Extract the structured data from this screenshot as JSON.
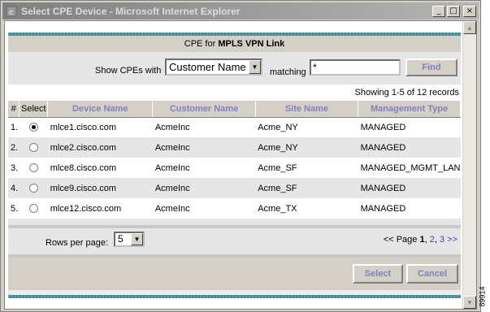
{
  "window": {
    "title": "Select CPE Device - Microsoft Internet Explorer",
    "minimize_glyph": "_",
    "maximize_glyph": "□",
    "close_glyph": "×"
  },
  "header": {
    "prefix": "CPE for ",
    "link_name": "MPLS VPN Link"
  },
  "filter": {
    "show_label": "Show CPEs with",
    "field_selected": "Customer Name",
    "matching_label": "matching",
    "search_value": "*",
    "find_label": "Find"
  },
  "records_text": "Showing 1-5 of 12 records",
  "table": {
    "columns": [
      "#",
      "Select",
      "Device Name",
      "Customer Name",
      "Site Name",
      "Management Type"
    ],
    "rows": [
      {
        "num": "1.",
        "selected": true,
        "device": "mlce1.cisco.com",
        "customer": "AcmeInc",
        "site": "Acme_NY",
        "mgmt": "MANAGED"
      },
      {
        "num": "2.",
        "selected": false,
        "device": "mlce2.cisco.com",
        "customer": "AcmeInc",
        "site": "Acme_NY",
        "mgmt": "MANAGED"
      },
      {
        "num": "3.",
        "selected": false,
        "device": "mlce8.cisco.com",
        "customer": "AcmeInc",
        "site": "Acme_SF",
        "mgmt": "MANAGED_MGMT_LAN"
      },
      {
        "num": "4.",
        "selected": false,
        "device": "mlce9.cisco.com",
        "customer": "AcmeInc",
        "site": "Acme_SF",
        "mgmt": "MANAGED"
      },
      {
        "num": "5.",
        "selected": false,
        "device": "mlce12.cisco.com",
        "customer": "AcmeInc",
        "site": "Acme_TX",
        "mgmt": "MANAGED"
      }
    ]
  },
  "pager": {
    "rows_label": "Rows per page:",
    "rows_value": "5",
    "prefix": "<< Page ",
    "current": "1",
    "sep1": ", ",
    "page2": "2",
    "sep2": ", ",
    "page3": "3",
    "next": " >>"
  },
  "actions": {
    "select_label": "Select",
    "cancel_label": "Cancel"
  },
  "figure_id": "89914",
  "colors": {
    "accent_text": "#8080c0",
    "teal_rule": "#3f8a90",
    "link": "#4040c0"
  },
  "icons": {
    "app": "ie-icon",
    "scroll_up": "scroll-up-arrow-icon",
    "scroll_down": "scroll-down-arrow-icon",
    "dropdown": "chevron-down-icon"
  }
}
